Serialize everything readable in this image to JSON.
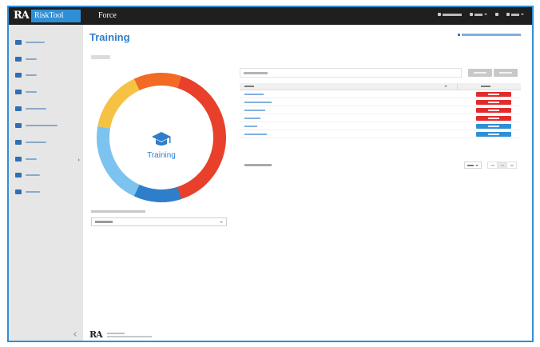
{
  "header": {
    "logo": "RA",
    "product": "RiskTool",
    "tenant": "Force",
    "items": [
      {
        "icon": "person-icon"
      },
      {
        "icon": "building-icon"
      },
      {
        "icon": "gear-icon"
      },
      {
        "icon": "user-icon"
      }
    ]
  },
  "sidebar": {
    "items": [
      {
        "icon": "dashboard-icon"
      },
      {
        "icon": "check-icon"
      },
      {
        "icon": "folder-icon"
      },
      {
        "icon": "list-icon"
      },
      {
        "icon": "team-icon"
      },
      {
        "icon": "link-icon"
      },
      {
        "icon": "document-icon"
      },
      {
        "icon": "lock-icon"
      },
      {
        "icon": "chart-icon"
      },
      {
        "icon": "truck-icon"
      }
    ]
  },
  "page": {
    "title": "Training"
  },
  "donut": {
    "label": "Training",
    "icon": "graduation-cap-icon",
    "colors": [
      "#e8402b",
      "#f26a24",
      "#f6c244",
      "#7cc3ef",
      "#2f7ec9"
    ]
  },
  "statuses": {
    "colors": {
      "red": "#e22b2b",
      "blue": "#2f8fd6"
    }
  },
  "table": {
    "rows": [
      {
        "status": "red"
      },
      {
        "status": "red"
      },
      {
        "status": "red"
      },
      {
        "status": "red"
      },
      {
        "status": "blue"
      },
      {
        "status": "blue"
      }
    ]
  },
  "footer": {
    "logo": "RA"
  }
}
